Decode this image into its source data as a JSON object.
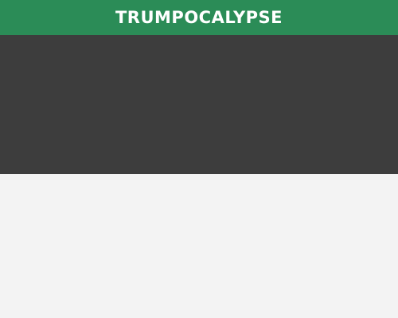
{
  "header": {
    "title": "TRUMPOCALYPSE"
  },
  "colors": {
    "header_bg": "#2b8c57",
    "banner_bg": "#3d3d3d",
    "page_bg": "#f3f3f3",
    "title_text": "#ffffff"
  }
}
